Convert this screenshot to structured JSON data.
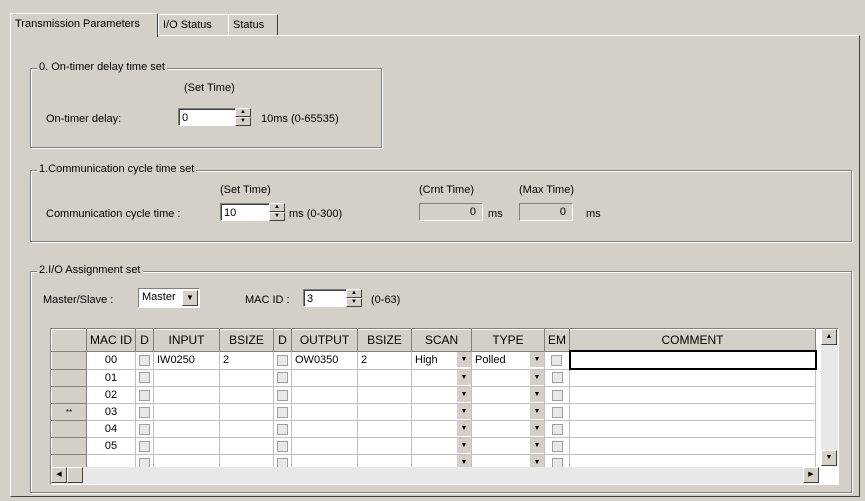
{
  "tabs": [
    {
      "label": "Transmission Parameters"
    },
    {
      "label": "I/O Status"
    },
    {
      "label": "Status"
    }
  ],
  "group0": {
    "title": "0. On-timer delay time set",
    "set_time_header": "(Set Time)",
    "label": "On-timer delay:",
    "value": "0",
    "unit": "10ms (0-65535)"
  },
  "group1": {
    "title": "1.Communication cycle time set",
    "set_time_header": "(Set Time)",
    "crnt_time_header": "(Crnt Time)",
    "max_time_header": "(Max Time)",
    "label": "Communication cycle time :",
    "value": "10",
    "unit": "ms (0-300)",
    "crnt_value": "0",
    "crnt_unit": "ms",
    "max_value": "0",
    "max_unit": "ms"
  },
  "group2": {
    "title": "2.I/O Assignment set",
    "master_slave_label": "Master/Slave :",
    "master_slave_value": "Master",
    "mac_id_label": "MAC ID :",
    "mac_id_value": "3",
    "mac_id_range": "(0-63)"
  },
  "grid": {
    "columns": [
      "MAC ID",
      "D",
      "INPUT",
      "BSIZE",
      "D",
      "OUTPUT",
      "BSIZE",
      "SCAN",
      "TYPE",
      "EM",
      "COMMENT"
    ],
    "rows": [
      {
        "marker": "",
        "mac": "00",
        "input": "IW0250",
        "bsize_in": "2",
        "output": "OW0350",
        "bsize_out": "2",
        "scan": "High",
        "type": "Polled",
        "comment": ""
      },
      {
        "marker": "",
        "mac": "01",
        "input": "",
        "bsize_in": "",
        "output": "",
        "bsize_out": "",
        "scan": "",
        "type": "",
        "comment": ""
      },
      {
        "marker": "",
        "mac": "02",
        "input": "",
        "bsize_in": "",
        "output": "",
        "bsize_out": "",
        "scan": "",
        "type": "",
        "comment": ""
      },
      {
        "marker": "**",
        "mac": "03",
        "input": "",
        "bsize_in": "",
        "output": "",
        "bsize_out": "",
        "scan": "",
        "type": "",
        "comment": ""
      },
      {
        "marker": "",
        "mac": "04",
        "input": "",
        "bsize_in": "",
        "output": "",
        "bsize_out": "",
        "scan": "",
        "type": "",
        "comment": ""
      },
      {
        "marker": "",
        "mac": "05",
        "input": "",
        "bsize_in": "",
        "output": "",
        "bsize_out": "",
        "scan": "",
        "type": "",
        "comment": ""
      },
      {
        "marker": "",
        "mac": "",
        "input": "",
        "bsize_in": "",
        "output": "",
        "bsize_out": "",
        "scan": "",
        "type": "",
        "comment": ""
      }
    ]
  },
  "icons": {
    "spin_up": "up-arrow-icon",
    "spin_down": "down-arrow-icon",
    "dropdown": "chevron-down-icon"
  }
}
